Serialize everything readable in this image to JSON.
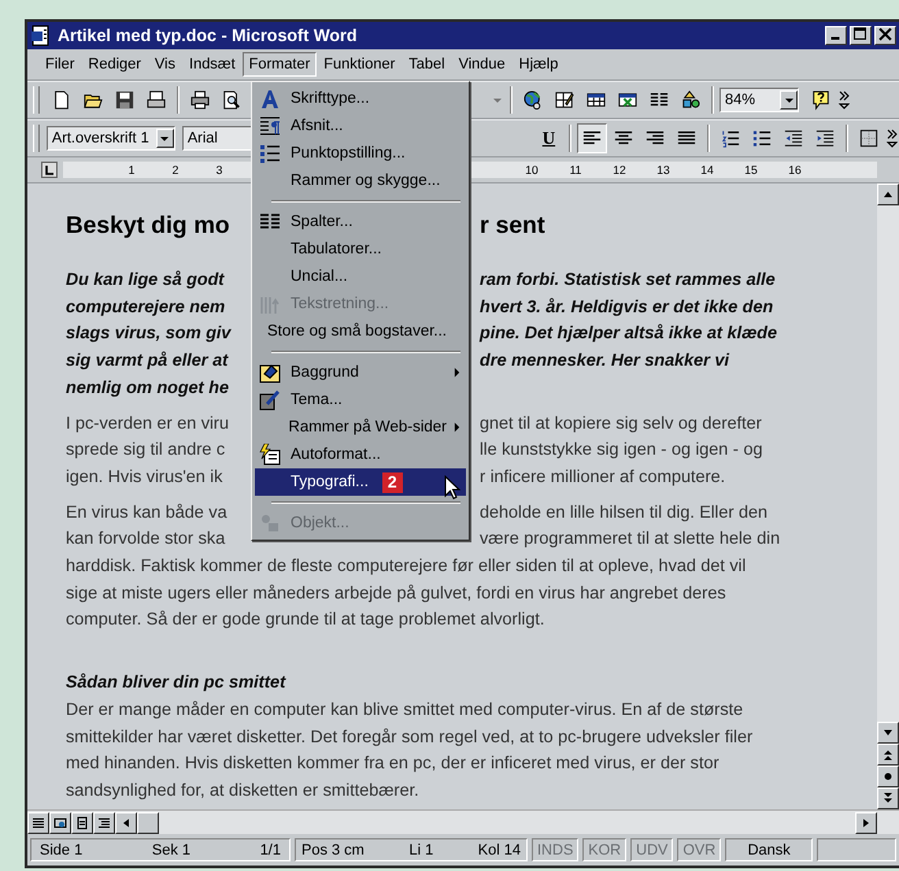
{
  "window": {
    "title": "Artikel med typ.doc - Microsoft Word"
  },
  "menu_bar": [
    {
      "label": "Filer",
      "selected": false
    },
    {
      "label": "Rediger",
      "selected": false
    },
    {
      "label": "Vis",
      "selected": false
    },
    {
      "label": "Indsæt",
      "selected": false
    },
    {
      "label": "Formater",
      "selected": true
    },
    {
      "label": "Funktioner",
      "selected": false
    },
    {
      "label": "Tabel",
      "selected": false
    },
    {
      "label": "Vindue",
      "selected": false
    },
    {
      "label": "Hjælp",
      "selected": false
    }
  ],
  "toolbar": {
    "zoom": "84%"
  },
  "formatting_toolbar": {
    "style": "Art.overskrift 1",
    "font": "Arial",
    "underline": "U",
    "alignment": [
      {
        "selected": true
      },
      {
        "selected": false
      },
      {
        "selected": false
      },
      {
        "selected": false
      }
    ]
  },
  "ruler": {
    "left_numbers": [
      "1",
      "2",
      "3"
    ],
    "right_numbers": [
      "10",
      "11",
      "12",
      "13",
      "14",
      "15",
      "16"
    ]
  },
  "document": {
    "blocks": [
      {
        "kind": "heading",
        "lines": [
          {
            "left": "Beskyt dig mo",
            "right": "r sent"
          }
        ]
      },
      {
        "kind": "lead",
        "lines": [
          {
            "left": "Du kan lige så godt",
            "right": "ram forbi. Statistisk set rammes alle"
          },
          {
            "left": "computerejere nem",
            "right": "hvert 3. år. Heldigvis er det ikke den"
          },
          {
            "left": "slags virus, som giv",
            "right": "pine. Det hjælper altså ikke at klæde"
          },
          {
            "left": "sig varmt på eller at",
            "right": "dre mennesker. Her snakker vi"
          },
          {
            "left": "nemlig om noget he"
          }
        ]
      },
      {
        "kind": "body",
        "lines": [
          {
            "left": "I pc-verden er en viru",
            "right": "gnet til at kopiere sig selv og derefter"
          },
          {
            "left": "sprede sig til andre c",
            "right": "lle kunststykke sig igen - og igen - og"
          },
          {
            "left": "igen. Hvis virus'en ik",
            "right": "r inficere millioner af computere."
          }
        ]
      },
      {
        "kind": "body",
        "lines": [
          {
            "left": "En virus kan både va",
            "right": "deholde en lille hilsen til dig. Eller den"
          },
          {
            "left": "kan forvolde stor ska",
            "right": "være programmeret til at slette hele din"
          },
          {
            "text": "harddisk. Faktisk kommer de fleste computerejere før eller siden til at opleve, hvad det vil"
          },
          {
            "text": "sige at miste ugers eller måneders arbejde på gulvet, fordi en virus har angrebet deres"
          },
          {
            "text": "computer. Så der er gode grunde til at tage problemet alvorligt."
          }
        ]
      },
      {
        "kind": "subheading",
        "lines": [
          {
            "text": "Sådan bliver din pc smittet"
          }
        ]
      },
      {
        "kind": "body_tight",
        "lines": [
          {
            "text": "Der er mange måder en computer kan blive smittet med computer-virus. En af de største"
          },
          {
            "text": "smittekilder har været disketter. Det foregår som regel ved, at to pc-brugere udveksler filer"
          },
          {
            "text": "med hinanden. Hvis disketten kommer fra en pc, der er inficeret med virus, er der stor"
          },
          {
            "text": "sandsynlighed for, at disketten er smittebærer."
          }
        ]
      }
    ]
  },
  "format_menu": {
    "items": [
      {
        "kind": "item",
        "label": "Skrifttype...",
        "disabled": false,
        "selected": false,
        "submenu": false
      },
      {
        "kind": "item",
        "label": "Afsnit...",
        "disabled": false,
        "selected": false,
        "submenu": false
      },
      {
        "kind": "item",
        "label": "Punktopstilling...",
        "disabled": false,
        "selected": false,
        "submenu": false
      },
      {
        "kind": "item",
        "label": "Rammer og skygge...",
        "disabled": false,
        "selected": false,
        "submenu": false
      },
      {
        "kind": "separator"
      },
      {
        "kind": "item",
        "label": "Spalter...",
        "disabled": false,
        "selected": false,
        "submenu": false
      },
      {
        "kind": "item",
        "label": "Tabulatorer...",
        "disabled": false,
        "selected": false,
        "submenu": false
      },
      {
        "kind": "item",
        "label": "Uncial...",
        "disabled": false,
        "selected": false,
        "submenu": false
      },
      {
        "kind": "item",
        "label": "Tekstretning...",
        "disabled": true,
        "selected": false,
        "submenu": false
      },
      {
        "kind": "item",
        "label": "Store og små bogstaver...",
        "disabled": false,
        "selected": false,
        "submenu": false
      },
      {
        "kind": "separator"
      },
      {
        "kind": "item",
        "label": "Baggrund",
        "disabled": false,
        "selected": false,
        "submenu": true
      },
      {
        "kind": "item",
        "label": "Tema...",
        "disabled": false,
        "selected": false,
        "submenu": false
      },
      {
        "kind": "item",
        "label": "Rammer på Web-sider",
        "disabled": false,
        "selected": false,
        "submenu": true
      },
      {
        "kind": "item",
        "label": "Autoformat...",
        "disabled": false,
        "selected": false,
        "submenu": false
      },
      {
        "kind": "item",
        "label": "Typografi...",
        "disabled": false,
        "selected": true,
        "submenu": false,
        "badge": "2"
      },
      {
        "kind": "separator"
      },
      {
        "kind": "item",
        "label": "Objekt...",
        "disabled": true,
        "selected": false,
        "submenu": false
      }
    ]
  },
  "status_bar": {
    "fields": [
      {
        "label": "Side 1"
      },
      {
        "label": "Sek 1"
      },
      {
        "label": "1/1"
      },
      {
        "label": "Pos 3 cm"
      },
      {
        "label": "Li 1"
      },
      {
        "label": "Kol 14"
      }
    ],
    "indicators": [
      {
        "label": "INDS",
        "disabled": true
      },
      {
        "label": "KOR",
        "disabled": true
      },
      {
        "label": "UDV",
        "disabled": true
      },
      {
        "label": "OVR",
        "disabled": true
      }
    ],
    "language": "Dansk"
  }
}
